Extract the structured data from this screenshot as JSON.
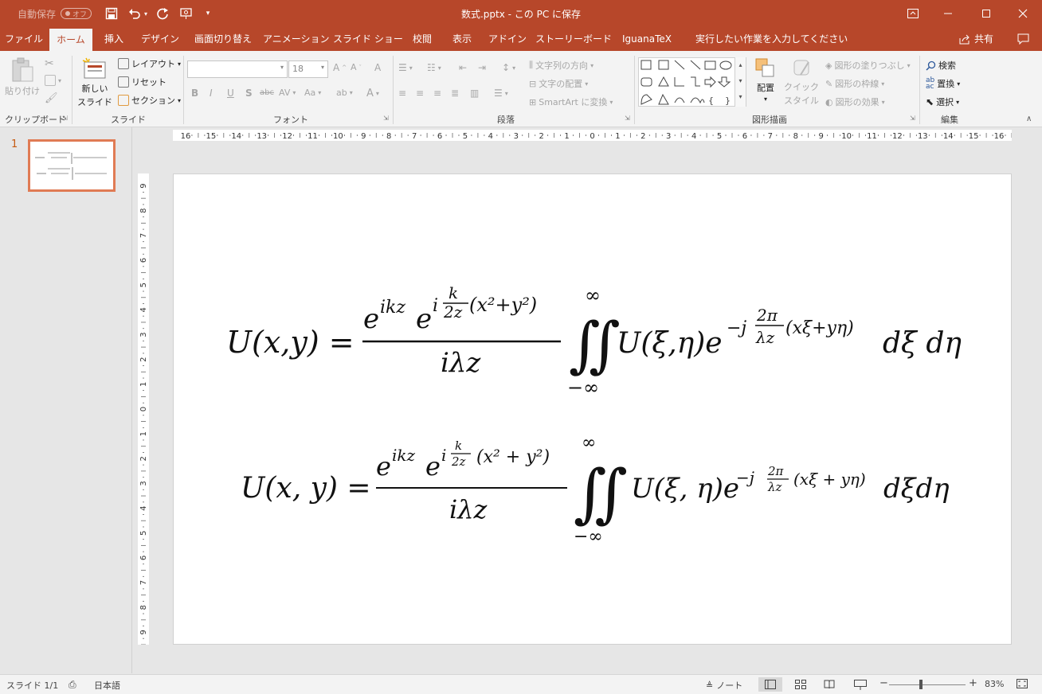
{
  "title_bar": {
    "autosave_label": "自動保存",
    "autosave_state": "オフ",
    "document_title": "数式.pptx - この PC に保存",
    "save_icon": "save-icon",
    "undo_icon": "undo-icon",
    "redo_icon": "redo-icon",
    "present_icon": "start-from-beginning-icon",
    "customize_icon": "customize-qat-icon",
    "window_controls": [
      "ribbon-display-options-icon",
      "minimize-icon",
      "maximize-icon",
      "close-icon"
    ]
  },
  "tabs": [
    {
      "label": "ファイル"
    },
    {
      "label": "ホーム"
    },
    {
      "label": "挿入"
    },
    {
      "label": "デザイン"
    },
    {
      "label": "画面切り替え"
    },
    {
      "label": "アニメーション"
    },
    {
      "label": "スライド ショー"
    },
    {
      "label": "校閲"
    },
    {
      "label": "表示"
    },
    {
      "label": "アドイン"
    },
    {
      "label": "ストーリーボード"
    },
    {
      "label": "IguanaTeX"
    }
  ],
  "active_tab": "ホーム",
  "tell_me": "実行したい作業を入力してください",
  "share": "共有",
  "ribbon": {
    "clipboard": {
      "label": "クリップボード",
      "paste": "貼り付け"
    },
    "slides": {
      "label": "スライド",
      "new_slide_1": "新しい",
      "new_slide_2": "スライド",
      "layout": "レイアウト",
      "reset": "リセット",
      "section": "セクション"
    },
    "font": {
      "label": "フォント",
      "font_name": "",
      "font_size": "18",
      "bold": "B",
      "italic": "I",
      "underline": "U",
      "shadow": "S",
      "strike": "abc",
      "spacing": "AV",
      "case": "Aa",
      "color": "A"
    },
    "paragraph": {
      "label": "段落",
      "text_direction": "文字列の方向",
      "align_text": "文字の配置",
      "smartart": "SmartArt に変換"
    },
    "drawing": {
      "label": "図形描画",
      "arrange": "配置",
      "quick_styles_1": "クイック",
      "quick_styles_2": "スタイル",
      "shape_fill": "図形の塗りつぶし",
      "shape_outline": "図形の枠線",
      "shape_effects": "図形の効果"
    },
    "editing": {
      "label": "編集",
      "find": "検索",
      "replace": "置換",
      "select": "選択"
    }
  },
  "slide_panel": {
    "slide_number": "1"
  },
  "ruler": {
    "h_labels": [
      "16",
      "15",
      "14",
      "13",
      "12",
      "11",
      "10",
      "9",
      "8",
      "7",
      "6",
      "5",
      "4",
      "3",
      "2",
      "1",
      "0",
      "1",
      "2",
      "3",
      "4",
      "5",
      "6",
      "7",
      "8",
      "9",
      "10",
      "11",
      "12",
      "13",
      "14",
      "15",
      "16"
    ],
    "v_labels": [
      "9",
      "8",
      "7",
      "6",
      "5",
      "4",
      "3",
      "2",
      "1",
      "0",
      "1",
      "2",
      "3",
      "4",
      "5",
      "6",
      "7",
      "8",
      "9"
    ]
  },
  "equations": {
    "eq1": {
      "lhs": "U(x,y) =",
      "num_e1": "e",
      "num_sup1": "ikz",
      "num_e2": "e",
      "num_sup_i": "i",
      "num_k": "k",
      "num_2z": "2z",
      "num_paren": "(x²+y²)",
      "den": "iλz",
      "int_sym": "∬",
      "int_upper": "∞",
      "int_lower": "−∞",
      "integrand": "U(ξ,η)e",
      "exp_minus_j": "−j",
      "exp_2pi": "2π",
      "exp_lz": "λz",
      "exp_paren": "(xξ+yη)",
      "diff": "dξ dη"
    },
    "eq2": {
      "lhs": "U(x, y) =",
      "num_e1": "e",
      "num_sup1": "ikz",
      "num_e2": "e",
      "num_sup_i": "i",
      "num_k": "k",
      "num_2z": "2z",
      "num_paren": "(x² + y²)",
      "den": "iλz",
      "int_sym": "∬",
      "int_upper": "∞",
      "int_lower": "−∞",
      "integrand": "U(ξ, η)e",
      "exp_minus_j": "−j",
      "exp_2pi": "2π",
      "exp_lz": "λz",
      "exp_paren": "(xξ + yη)",
      "diff": "dξdη"
    }
  },
  "status_bar": {
    "slide_info": "スライド 1/1",
    "language": "日本語",
    "notes": "ノート",
    "zoom": "83%",
    "zoom_level": 0.83
  }
}
